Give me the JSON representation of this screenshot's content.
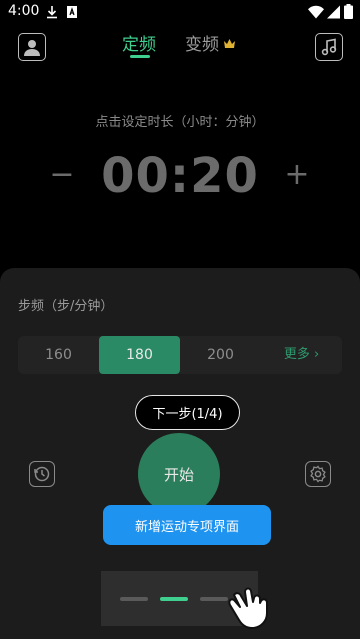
{
  "status_bar": {
    "time": "4:00"
  },
  "header": {
    "tabs": [
      {
        "label": "定频",
        "active": true
      },
      {
        "label": "变频",
        "active": false,
        "badge": "crown-icon"
      }
    ]
  },
  "timer": {
    "hint": "点击设定时长（小时：分钟）",
    "value": "00:20",
    "minus": "−",
    "plus": "+"
  },
  "cadence": {
    "title": "步频（步/分钟）",
    "options": [
      "160",
      "180",
      "200"
    ],
    "selected": "180",
    "more": "更多 ›"
  },
  "guide": {
    "step": "下一步(1/4)",
    "tooltip": "新增运动专项界面"
  },
  "controls": {
    "start": "开始"
  },
  "colors": {
    "accent": "#3fcf8e",
    "start": "#2b7e5b",
    "tooltip": "#1f93f0"
  }
}
